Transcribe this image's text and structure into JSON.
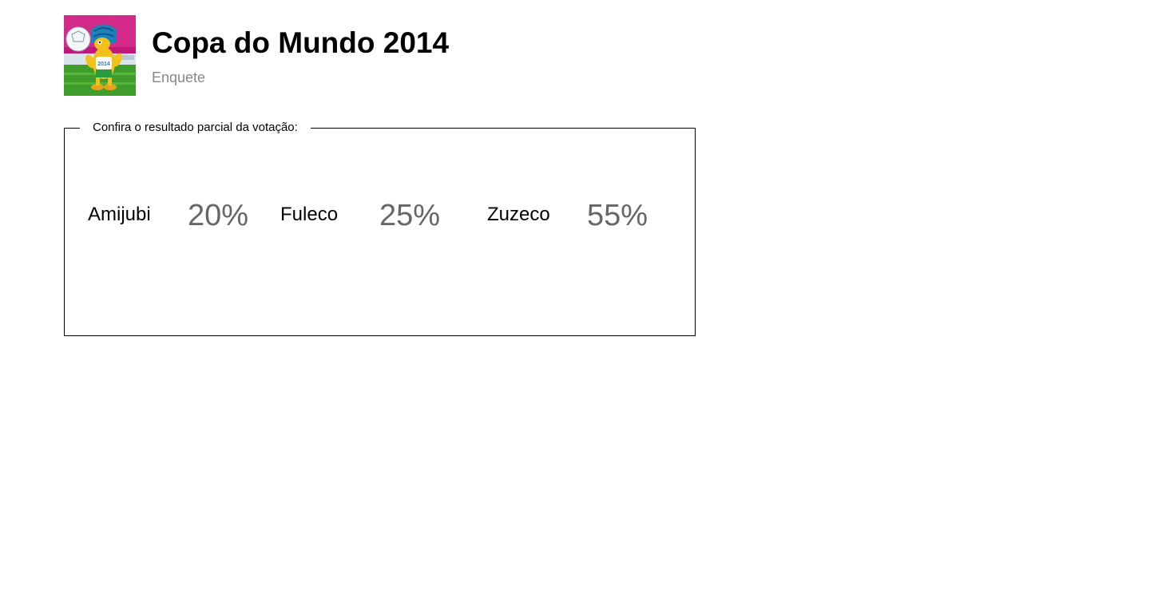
{
  "header": {
    "thumbnail_alt": "mascot-thumbnail",
    "title": "Copa do Mundo 2014",
    "subtitle": "Enquete",
    "title_color": "#000000",
    "subtitle_color": "#888888",
    "thumbnail_bg": "#c2187a",
    "thumbnail_grass": "#3f9e2b"
  },
  "poll": {
    "legend": "Confira o resultado parcial da votação:",
    "options": [
      {
        "name": "Amijubi",
        "percent_label": "20%",
        "percent": 20
      },
      {
        "name": "Fuleco",
        "percent_label": "25%",
        "percent": 25
      },
      {
        "name": "Zuzeco",
        "percent_label": "55%",
        "percent": 55
      }
    ],
    "name_color": "#000000",
    "percent_color": "#666666"
  }
}
